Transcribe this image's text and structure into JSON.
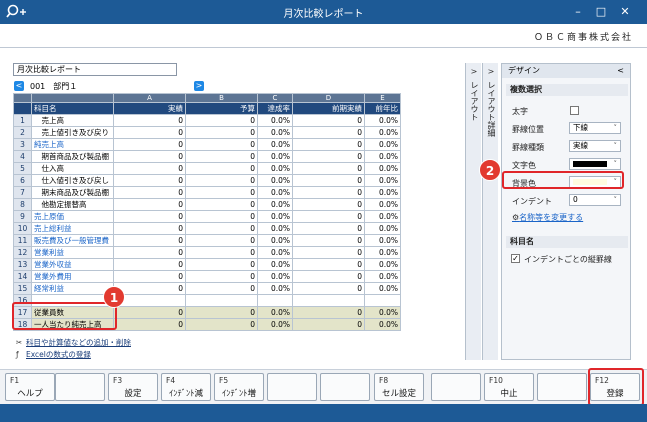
{
  "window": {
    "title": "月次比較レポート",
    "controls": [
      "–",
      "□",
      "✕"
    ]
  },
  "company": "ＯＢＣ商事株式会社",
  "report_name": "月次比較レポート",
  "department": "001　部門１",
  "grid": {
    "letters": [
      "A",
      "B",
      "C",
      "D",
      "E"
    ],
    "headers": [
      "科目名",
      "実績",
      "予算",
      "達成率",
      "前期実績",
      "前年比"
    ],
    "rows": [
      {
        "n": "1",
        "label": "　売上高",
        "a": "0",
        "b": "0",
        "c": "0.0%",
        "d": "0",
        "e": "0.0%",
        "blue": false
      },
      {
        "n": "2",
        "label": "　売上値引き及び戻り",
        "a": "0",
        "b": "0",
        "c": "0.0%",
        "d": "0",
        "e": "0.0%",
        "blue": false
      },
      {
        "n": "3",
        "label": "純売上高",
        "a": "0",
        "b": "0",
        "c": "0.0%",
        "d": "0",
        "e": "0.0%",
        "blue": true
      },
      {
        "n": "4",
        "label": "　期首商品及び製品棚",
        "a": "0",
        "b": "0",
        "c": "0.0%",
        "d": "0",
        "e": "0.0%",
        "blue": false
      },
      {
        "n": "5",
        "label": "　仕入高",
        "a": "0",
        "b": "0",
        "c": "0.0%",
        "d": "0",
        "e": "0.0%",
        "blue": false
      },
      {
        "n": "6",
        "label": "　仕入値引き及び戻し",
        "a": "0",
        "b": "0",
        "c": "0.0%",
        "d": "0",
        "e": "0.0%",
        "blue": false
      },
      {
        "n": "7",
        "label": "　期末商品及び製品棚",
        "a": "0",
        "b": "0",
        "c": "0.0%",
        "d": "0",
        "e": "0.0%",
        "blue": false
      },
      {
        "n": "8",
        "label": "　他勘定振替高",
        "a": "0",
        "b": "0",
        "c": "0.0%",
        "d": "0",
        "e": "0.0%",
        "blue": false
      },
      {
        "n": "9",
        "label": "売上原価",
        "a": "0",
        "b": "0",
        "c": "0.0%",
        "d": "0",
        "e": "0.0%",
        "blue": true
      },
      {
        "n": "10",
        "label": "売上総利益",
        "a": "0",
        "b": "0",
        "c": "0.0%",
        "d": "0",
        "e": "0.0%",
        "blue": true
      },
      {
        "n": "11",
        "label": "販売費及び一般管理費",
        "a": "0",
        "b": "0",
        "c": "0.0%",
        "d": "0",
        "e": "0.0%",
        "blue": true
      },
      {
        "n": "12",
        "label": "営業利益",
        "a": "0",
        "b": "0",
        "c": "0.0%",
        "d": "0",
        "e": "0.0%",
        "blue": true
      },
      {
        "n": "13",
        "label": "営業外収益",
        "a": "0",
        "b": "0",
        "c": "0.0%",
        "d": "0",
        "e": "0.0%",
        "blue": true
      },
      {
        "n": "14",
        "label": "営業外費用",
        "a": "0",
        "b": "0",
        "c": "0.0%",
        "d": "0",
        "e": "0.0%",
        "blue": true
      },
      {
        "n": "15",
        "label": "経常利益",
        "a": "0",
        "b": "0",
        "c": "0.0%",
        "d": "0",
        "e": "0.0%",
        "blue": true
      },
      {
        "n": "16",
        "label": "",
        "a": "",
        "b": "",
        "c": "",
        "d": "",
        "e": "",
        "blue": false
      },
      {
        "n": "17",
        "label": "従業員数",
        "a": "0",
        "b": "0",
        "c": "0.0%",
        "d": "0",
        "e": "0.0%",
        "blue": false,
        "special": true
      },
      {
        "n": "18",
        "label": "一人当たり純売上高",
        "a": "0",
        "b": "0",
        "c": "0.0%",
        "d": "0",
        "e": "0.0%",
        "blue": false,
        "special": true
      }
    ]
  },
  "links": {
    "add_remove": "科目や計算値などの追加・削除",
    "excel": "Excelの数式の登録"
  },
  "side_tabs": {
    "layout": "レイアウト",
    "layout_detail": "レイアウト詳細"
  },
  "panel": {
    "title": "デザイン",
    "back": "<",
    "section_multi": "複数選択",
    "bold_label": "太字",
    "border_pos_label": "罫線位置",
    "border_pos_value": "下線",
    "border_type_label": "罫線種類",
    "border_type_value": "実線",
    "text_color_label": "文字色",
    "bg_color_label": "背景色",
    "indent_label": "インデント",
    "indent_value": "0",
    "rename_link": "名称等を変更する",
    "section_account": "科目名",
    "indent_border_label": "インデントごとの縦罫線"
  },
  "badges": [
    "1",
    "2"
  ],
  "fkeys": [
    {
      "fn": "F1",
      "label": "ヘルプ"
    },
    {
      "fn": "",
      "label": ""
    },
    {
      "fn": "F3",
      "label": "設定"
    },
    {
      "fn": "F4",
      "label": "ｲﾝﾃﾞﾝﾄ減"
    },
    {
      "fn": "F5",
      "label": "ｲﾝﾃﾞﾝﾄ増"
    },
    {
      "fn": "",
      "label": ""
    },
    {
      "fn": "",
      "label": ""
    },
    {
      "fn": "F8",
      "label": "セル設定"
    },
    {
      "fn": "",
      "label": ""
    },
    {
      "fn": "F10",
      "label": "中止"
    },
    {
      "fn": "",
      "label": ""
    },
    {
      "fn": "F12",
      "label": "登録"
    }
  ],
  "colors": {
    "titlebar": "#1d5a96",
    "header": "#21497e",
    "highlight": "#e0262a",
    "text_color_swatch": "#000000",
    "bg_color_swatch": "#fffde0",
    "blue_label": "#1a64c8"
  }
}
